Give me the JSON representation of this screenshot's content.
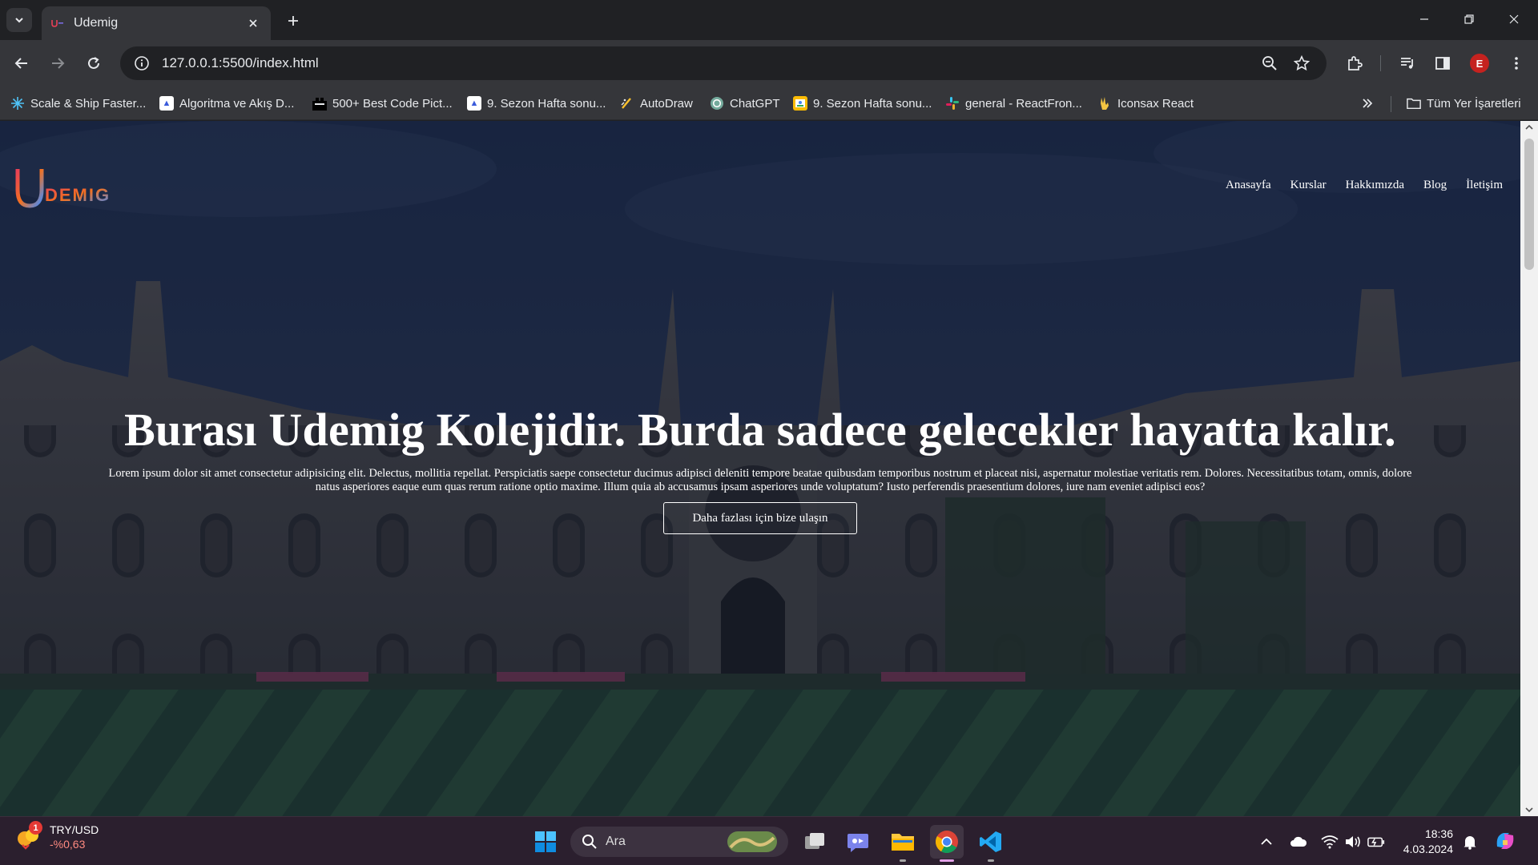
{
  "browser": {
    "tab_title": "Udemig",
    "url": "127.0.0.1:5500/index.html",
    "avatar_letter": "E",
    "bookmarks": [
      {
        "label": "Scale & Ship Faster...",
        "icon": "scale-icon",
        "color": "#4fc3f7"
      },
      {
        "label": "Algoritma ve Akış D...",
        "icon": "doc-icon",
        "color": "#ffffff"
      },
      {
        "label": "500+ Best Code Pict...",
        "icon": "code-icon",
        "color": "#222222"
      },
      {
        "label": "9. Sezon Hafta sonu...",
        "icon": "doc-icon",
        "color": "#ffffff"
      },
      {
        "label": "AutoDraw",
        "icon": "pencil-icon",
        "color": "#fbc02d"
      },
      {
        "label": "ChatGPT",
        "icon": "openai-icon",
        "color": "#74aa9c"
      },
      {
        "label": "9. Sezon Hafta sonu...",
        "icon": "slides-icon",
        "color": "#fbbc04"
      },
      {
        "label": "general - ReactFron...",
        "icon": "slack-icon",
        "color": "#e01e5a"
      },
      {
        "label": "Iconsax React",
        "icon": "hand-icon",
        "color": "#f4c542"
      }
    ],
    "all_bookmarks_label": "Tüm Yer İşaretleri"
  },
  "site": {
    "logo_text": "Udemig",
    "nav": [
      "Anasayfa",
      "Kurslar",
      "Hakkımızda",
      "Blog",
      "İletişim"
    ],
    "hero_title": "Burası Udemig Kolejidir. Burda sadece gelecekler hayatta kalır.",
    "hero_text": "Lorem ipsum dolor sit amet consectetur adipisicing elit. Delectus, mollitia repellat. Perspiciatis saepe consectetur ducimus adipisci deleniti tempore beatae quibusdam temporibus nostrum et placeat nisi, aspernatur molestiae veritatis rem. Dolores. Necessitatibus totam, omnis, dolore natus asperiores eaque eum quas rerum ratione optio maxime. Illum quia ab accusamus ipsam asperiores unde voluptatum? Iusto perferendis praesentium dolores, iure nam eveniet adipisci eos?",
    "hero_button": "Daha fazlası için bize ulaşın"
  },
  "taskbar": {
    "widget_title": "TRY/USD",
    "widget_value": "-%0,63",
    "widget_badge": "1",
    "search_placeholder": "Ara",
    "time": "18:36",
    "date": "4.03.2024"
  },
  "colors": {
    "chrome_dark": "#202124",
    "chrome_mid": "#35363a",
    "hero_overlay": "#1b2a4a",
    "logo_gradient_start": "#e94057",
    "logo_gradient_end": "#3f8cff"
  }
}
